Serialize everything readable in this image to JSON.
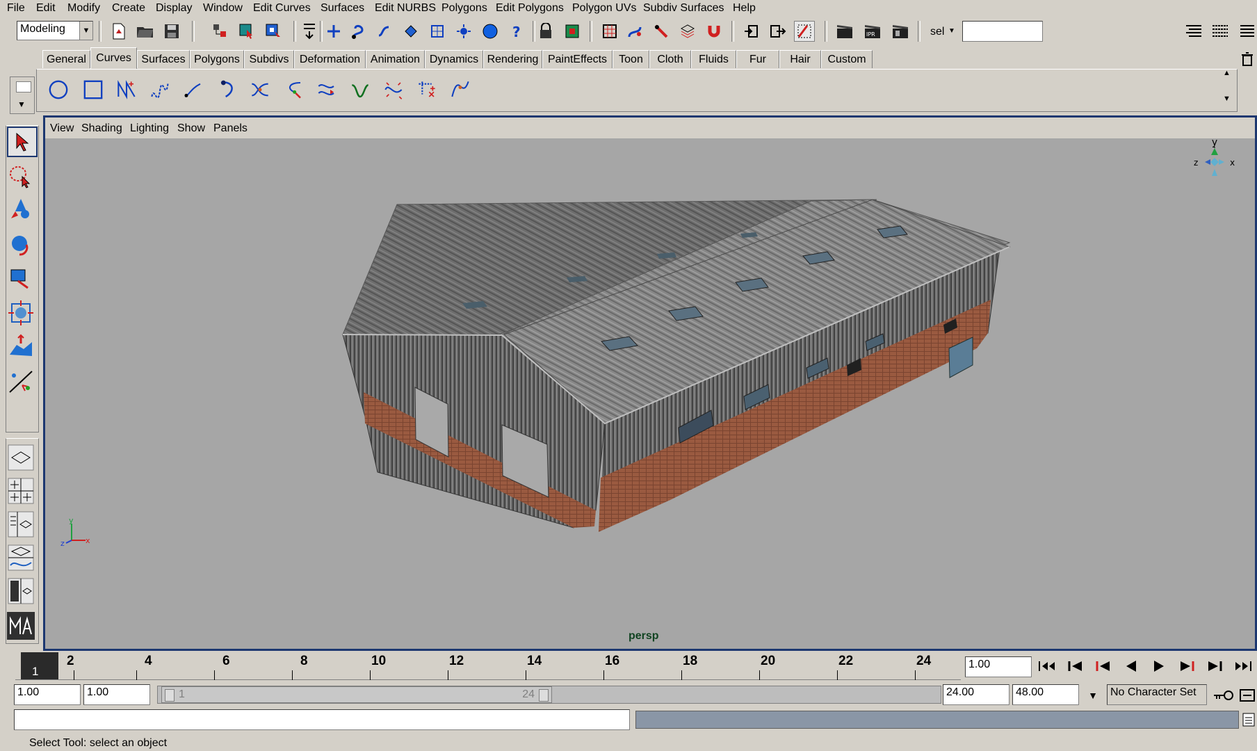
{
  "menubar": [
    "File",
    "Edit",
    "Modify",
    "Create",
    "Display",
    "Window",
    "Edit Curves",
    "Surfaces",
    "Edit NURBS",
    "Polygons",
    "Edit Polygons",
    "Polygon UVs",
    "Subdiv Surfaces",
    "Help"
  ],
  "toolbar": {
    "mode": "Modeling",
    "sel_label": "sel"
  },
  "shelf": {
    "tabs": [
      "General",
      "Curves",
      "Surfaces",
      "Polygons",
      "Subdivs",
      "Deformation",
      "Animation",
      "Dynamics",
      "Rendering",
      "PaintEffects",
      "Toon",
      "Cloth",
      "Fluids",
      "Fur",
      "Hair",
      "Custom"
    ],
    "active_tab": "Curves"
  },
  "viewport": {
    "menus": [
      "View",
      "Shading",
      "Lighting",
      "Show",
      "Panels"
    ],
    "camera_label": "persp",
    "axis_labels": {
      "y": "y",
      "x": "x",
      "z": "z"
    }
  },
  "timeline": {
    "ticks": [
      "2",
      "4",
      "6",
      "8",
      "10",
      "12",
      "14",
      "16",
      "18",
      "20",
      "22",
      "24"
    ],
    "current_frame": "1",
    "current_time": "1.00"
  },
  "range": {
    "start": "1.00",
    "playback_start": "1.00",
    "slider_start": "1",
    "slider_end": "24",
    "playback_end": "24.00",
    "end": "48.00",
    "character_set": "No Character Set"
  },
  "status": {
    "help_line": "Select Tool: select an object"
  }
}
